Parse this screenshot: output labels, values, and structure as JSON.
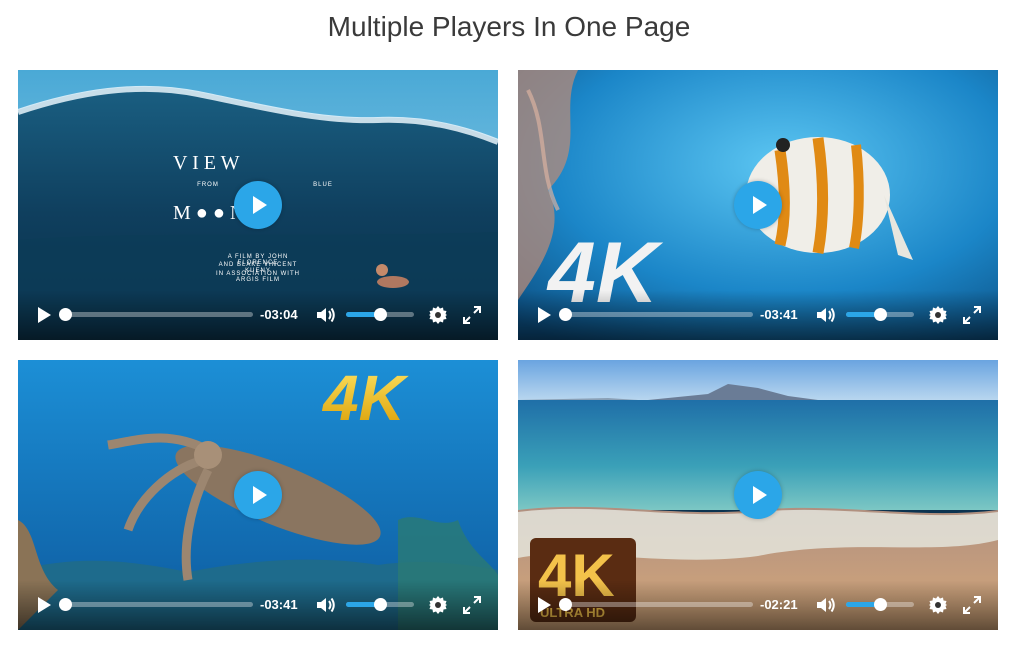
{
  "page": {
    "title": "Multiple Players In One Page"
  },
  "colors": {
    "accent": "#2ba6e8",
    "track": "rgba(255,255,255,0.35)",
    "title": "#3a3a3a"
  },
  "players": [
    {
      "id": "player-1",
      "poster": "ocean wave with surfer and film title",
      "time_remaining": "-03:04",
      "progress": 0.0,
      "volume": 0.5,
      "overlay_text": {
        "title_line1": "V   I   E   W",
        "from": "FROM",
        "blue": "BLUE",
        "title_line2": "M   ●   ●   N",
        "credit1": "A FILM BY JOHN FLORENCE",
        "credit2": "AND BLAKE VINCENT KUENY",
        "credit3": "IN ASSOCIATION WITH ARGIS FILM"
      }
    },
    {
      "id": "player-2",
      "poster": "butterflyfish over coral, 4K badge",
      "badge": "4K",
      "time_remaining": "-03:41",
      "progress": 0.0,
      "volume": 0.5
    },
    {
      "id": "player-3",
      "poster": "cuttlefish over reef, gold 4K badge",
      "badge": "4K",
      "time_remaining": "-03:41",
      "progress": 0.0,
      "volume": 0.5
    },
    {
      "id": "player-4",
      "poster": "sandy beach with waves, 4K ULTRA HD badge",
      "badge": "4K",
      "badge_sub": "ULTRA HD",
      "time_remaining": "-02:21",
      "progress": 0.0,
      "volume": 0.5
    }
  ],
  "icons": {
    "big_play": "play-icon",
    "play": "play-icon",
    "volume": "volume-icon",
    "settings": "gear-icon",
    "fullscreen": "fullscreen-icon"
  }
}
